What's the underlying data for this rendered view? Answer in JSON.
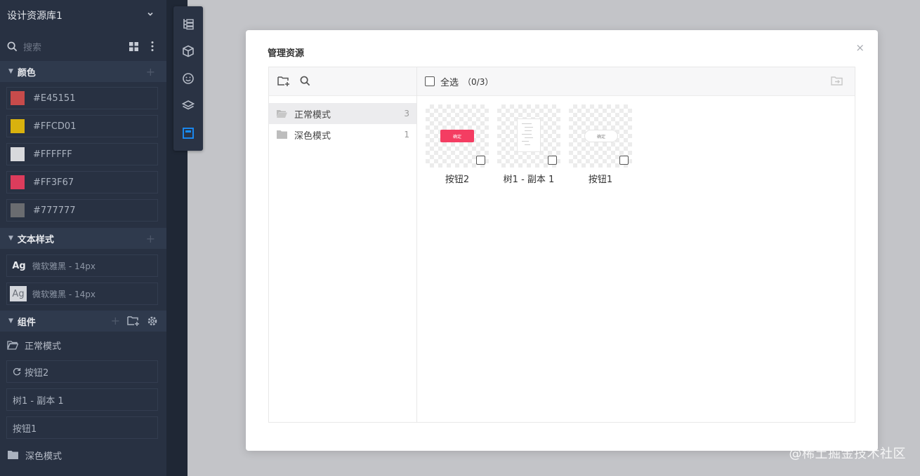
{
  "library": {
    "title": "设计资源库1",
    "search_placeholder": "搜索",
    "icons": {
      "chevron": "chevron-down-icon",
      "search": "search-icon",
      "grid": "grid-icon",
      "more": "more-vertical-icon"
    }
  },
  "colors_section": {
    "title": "颜色",
    "items": [
      {
        "hex": "#E45151",
        "label": "#E45151"
      },
      {
        "hex": "#FFCD01",
        "label": "#FFCD01"
      },
      {
        "hex": "#FFFFFF",
        "label": "#FFFFFF"
      },
      {
        "hex": "#FF3F67",
        "label": "#FF3F67"
      },
      {
        "hex": "#777777",
        "label": "#777777"
      }
    ]
  },
  "text_section": {
    "title": "文本样式",
    "items": [
      {
        "sample": "Ag",
        "label": "微软雅黑 - 14px"
      },
      {
        "sample": "Ag",
        "label": "微软雅黑 - 14px"
      }
    ]
  },
  "components_section": {
    "title": "组件",
    "folder_normal": "正常模式",
    "items": [
      "按钮2",
      "树1 - 副本 1",
      "按钮1"
    ],
    "folder_dark": "深色模式"
  },
  "toolbar": {
    "tools": [
      "outline-tree-icon",
      "cube-icon",
      "smile-icon",
      "layers-icon",
      "frame-icon"
    ],
    "active": "frame-icon",
    "accent": "#1890ff"
  },
  "modal": {
    "title": "管理资源",
    "close": "×",
    "folders": [
      {
        "name": "正常模式",
        "count": "3"
      },
      {
        "name": "深色模式",
        "count": "1"
      }
    ],
    "select_all": "全选",
    "select_count": "（0/3）",
    "assets": [
      {
        "name": "按钮2",
        "preview_text": "确定"
      },
      {
        "name": "树1 - 副本 1",
        "preview_text": ""
      },
      {
        "name": "按钮1",
        "preview_text": "确定"
      }
    ]
  },
  "watermark": "@稀土掘金技术社区"
}
